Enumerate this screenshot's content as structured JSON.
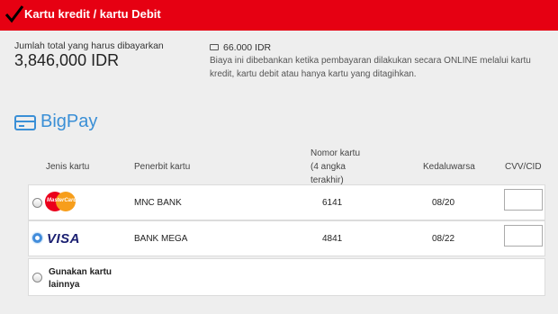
{
  "header": {
    "title": "Kartu kredit / kartu Debit"
  },
  "summary": {
    "total_label": "Jumlah total yang harus dibayarkan",
    "total_amount": "3,846,000 IDR",
    "fee": "66.000 IDR",
    "fee_note": "Biaya ini dibebankan ketika pembayaran dilakukan secara ONLINE melalui kartu kredit, kartu debit atau hanya kartu yang ditagihkan."
  },
  "brand": {
    "name": "BigPay",
    "color": "#3a8fd6"
  },
  "table": {
    "columns": {
      "card_type": "Jenis kartu",
      "issuer": "Penerbit kartu",
      "card_number": "Nomor kartu\n(4 angka\nterakhir)",
      "expiry": "Kedaluwarsa",
      "cvv": "CVV/CID"
    },
    "rows": [
      {
        "brand": "MasterCard",
        "issuer": "MNC BANK",
        "last4": "6141",
        "expiry": "08/20",
        "selected": false
      },
      {
        "brand": "VISA",
        "issuer": "BANK MEGA",
        "last4": "4841",
        "expiry": "08/22",
        "selected": true
      }
    ],
    "other_card_label": "Gunakan kartu\nlainnya"
  },
  "colors": {
    "header_bg": "#e60012",
    "accent": "#3a8fd6"
  }
}
